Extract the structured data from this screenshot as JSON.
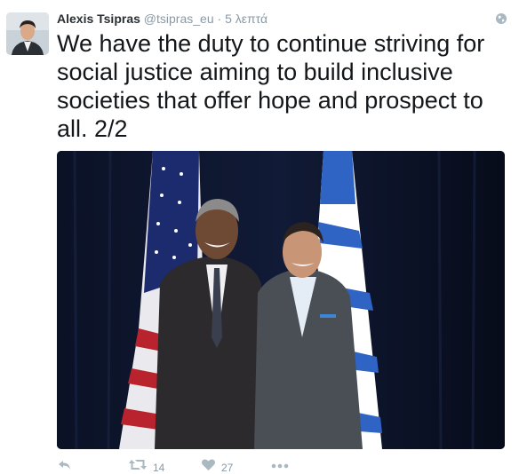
{
  "tweet": {
    "author_name": "Alexis Tsipras",
    "handle": "@tsipras_eu",
    "separator": "·",
    "time": "5 λεπτά",
    "text": "We have the duty to continue striving for social justice aiming to build inclusive societies that offer hope and prospect to all. 2/2"
  },
  "actions": {
    "retweet_count": "14",
    "like_count": "27"
  },
  "colors": {
    "name": "#292f33",
    "meta": "#8899a6",
    "text": "#14171a",
    "icon": "#aab8c2"
  },
  "icons": {
    "globe": "globe-icon",
    "reply": "reply-icon",
    "retweet": "retweet-icon",
    "like": "heart-icon",
    "more": "more-icon"
  }
}
